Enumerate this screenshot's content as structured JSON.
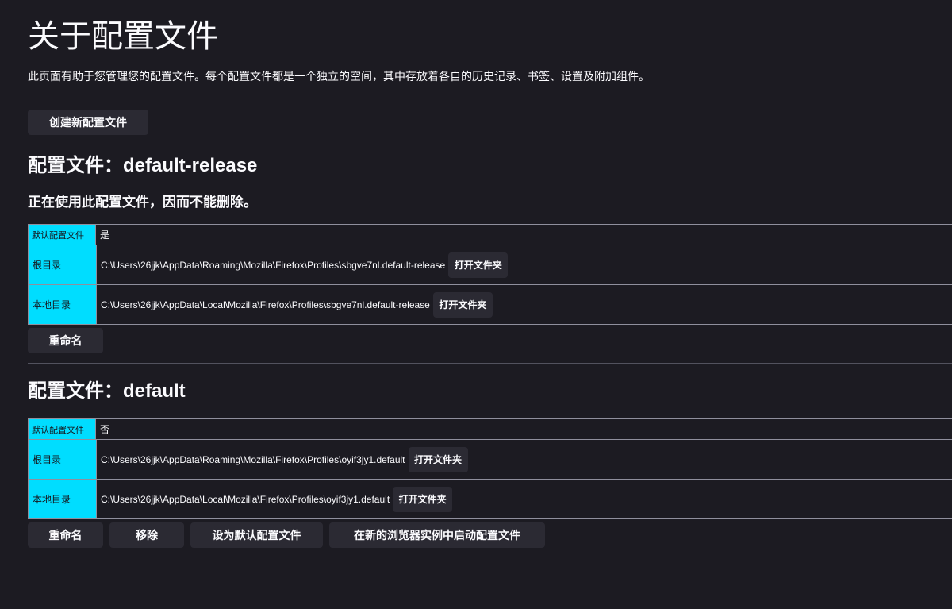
{
  "page": {
    "title": "关于配置文件",
    "description": "此页面有助于您管理您的配置文件。每个配置文件都是一个独立的空间，其中存放着各自的历史记录、书签、设置及附加组件。",
    "create_button": "创建新配置文件"
  },
  "labels": {
    "default_profile": "默认配置文件",
    "root_dir": "根目录",
    "local_dir": "本地目录",
    "open_folder": "打开文件夹"
  },
  "profiles": [
    {
      "heading": "配置文件：default-release",
      "in_use_note": "正在使用此配置文件，因而不能删除。",
      "is_default": "是",
      "root_dir": "C:\\Users\\26jjk\\AppData\\Roaming\\Mozilla\\Firefox\\Profiles\\sbgve7nl.default-release",
      "local_dir": "C:\\Users\\26jjk\\AppData\\Local\\Mozilla\\Firefox\\Profiles\\sbgve7nl.default-release",
      "actions": {
        "rename": "重命名"
      }
    },
    {
      "heading": "配置文件：default",
      "is_default": "否",
      "root_dir": "C:\\Users\\26jjk\\AppData\\Roaming\\Mozilla\\Firefox\\Profiles\\oyif3jy1.default",
      "local_dir": "C:\\Users\\26jjk\\AppData\\Local\\Mozilla\\Firefox\\Profiles\\oyif3jy1.default",
      "actions": {
        "rename": "重命名",
        "remove": "移除",
        "set_default": "设为默认配置文件",
        "launch": "在新的浏览器实例中启动配置文件"
      }
    }
  ],
  "colors": {
    "background": "#1c1b22",
    "label_cell": "#00ddff",
    "button": "#2b2a33",
    "text": "#fbfbfe"
  }
}
